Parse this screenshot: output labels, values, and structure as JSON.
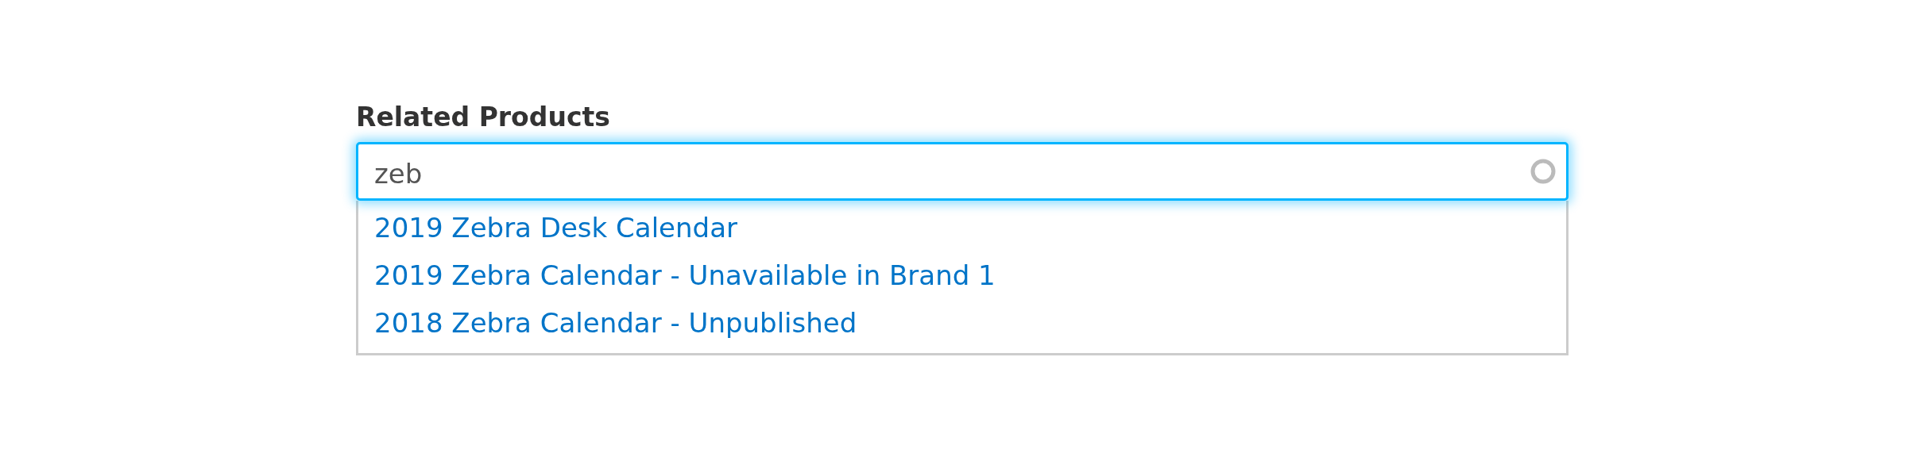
{
  "field": {
    "label": "Related Products",
    "value": "zeb",
    "loading": true
  },
  "suggestions": [
    {
      "label": "2019 Zebra Desk Calendar"
    },
    {
      "label": "2019 Zebra Calendar - Unavailable in Brand 1"
    },
    {
      "label": "2018 Zebra Calendar - Unpublished"
    }
  ]
}
